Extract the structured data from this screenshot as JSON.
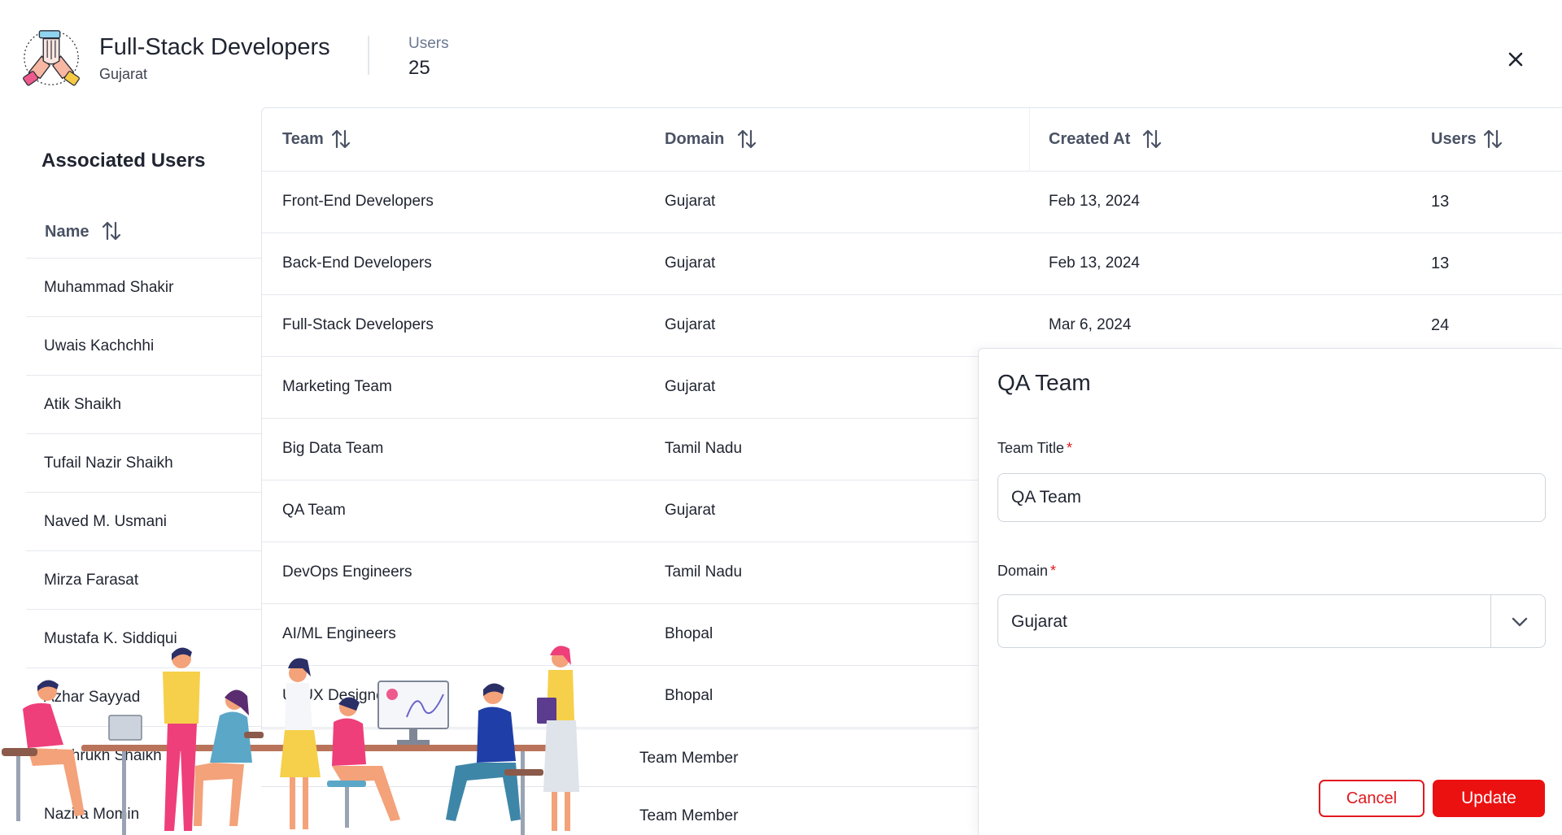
{
  "header": {
    "title": "Full-Stack Developers",
    "subtitle": "Gujarat",
    "users_label": "Users",
    "users_count": "25",
    "logo_icon": "team-hands-icon",
    "close_icon": "close-icon"
  },
  "associated": {
    "title": "Associated Users",
    "column_name": "Name",
    "users": [
      "Muhammad Shakir",
      "Uwais Kachchhi",
      "Atik Shaikh",
      "Tufail Nazir Shaikh",
      "Naved M. Usmani",
      "Mirza Farasat",
      "Mustafa K. Siddiqui",
      "Azhar Sayyad",
      "Shahrukh Shaikh",
      "Nazira Momin"
    ],
    "roles": [
      "Team Member",
      "Team Member"
    ]
  },
  "teams_table": {
    "columns": [
      "Team",
      "Domain",
      "Created At",
      "Users"
    ],
    "rows": [
      {
        "team": "Front-End Developers",
        "domain": "Gujarat",
        "created": "Feb 13, 2024",
        "users": "13"
      },
      {
        "team": "Back-End Developers",
        "domain": "Gujarat",
        "created": "Feb 13, 2024",
        "users": "13"
      },
      {
        "team": "Full-Stack Developers",
        "domain": "Gujarat",
        "created": "Mar 6, 2024",
        "users": "24"
      },
      {
        "team": "Marketing Team",
        "domain": "Gujarat"
      },
      {
        "team": "Big Data Team",
        "domain": "Tamil Nadu"
      },
      {
        "team": "QA Team",
        "domain": "Gujarat"
      },
      {
        "team": "DevOps Engineers",
        "domain": "Tamil Nadu"
      },
      {
        "team": "AI/ML Engineers",
        "domain": "Bhopal"
      },
      {
        "team": "UI/UX Designers",
        "domain": "Bhopal"
      }
    ]
  },
  "edit_panel": {
    "title": "QA Team",
    "team_title_label": "Team Title",
    "team_title_value": "QA Team",
    "domain_label": "Domain",
    "domain_value": "Gujarat",
    "required_mark": "*",
    "cancel_label": "Cancel",
    "update_label": "Update"
  },
  "colors": {
    "accent": "#ec1111",
    "text": "#1f2430",
    "muted": "#6b7891",
    "border": "#e6e8ee"
  }
}
